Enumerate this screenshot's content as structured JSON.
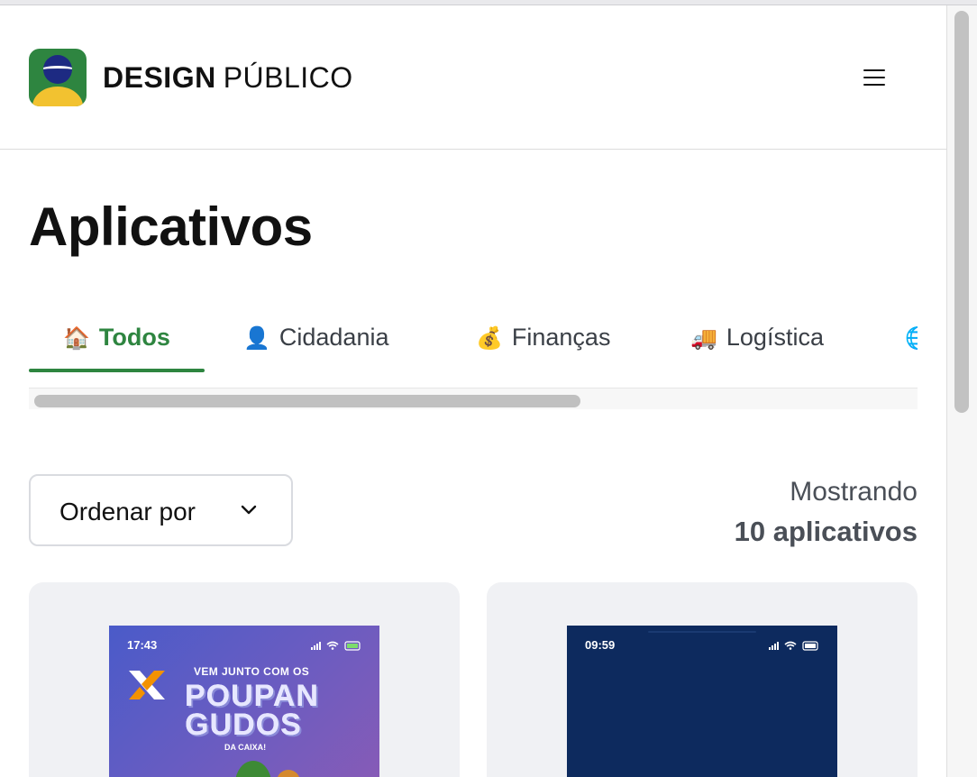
{
  "header": {
    "brand_bold": "DESIGN",
    "brand_light": "PÚBLICO"
  },
  "page": {
    "title": "Aplicativos"
  },
  "tabs": [
    {
      "emoji": "🏠",
      "label": "Todos",
      "active": true
    },
    {
      "emoji": "👤",
      "label": "Cidadania",
      "active": false
    },
    {
      "emoji": "💰",
      "label": "Finanças",
      "active": false
    },
    {
      "emoji": "🚚",
      "label": "Logística",
      "active": false
    },
    {
      "emoji": "🌐",
      "label": "",
      "active": false
    }
  ],
  "sort": {
    "label": "Ordenar por"
  },
  "results": {
    "line1": "Mostrando",
    "line2": "10 aplicativos"
  },
  "cards": [
    {
      "time": "17:43",
      "promo_top": "VEM JUNTO COM OS",
      "promo_big": "POUPAN GUDOS",
      "promo_small": "DA CAIXA!"
    },
    {
      "time": "09:59"
    }
  ],
  "colors": {
    "accent": "#2e8540",
    "card_bg": "#f0f1f4"
  }
}
